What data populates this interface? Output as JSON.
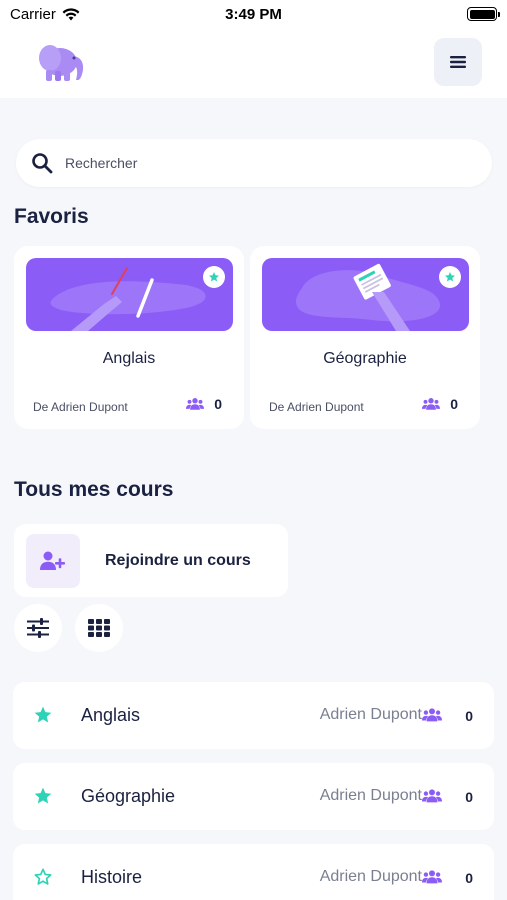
{
  "status_bar": {
    "carrier": "Carrier",
    "time": "3:49 PM"
  },
  "header": {
    "logo_icon": "elephant-logo",
    "menu_icon": "hamburger-icon"
  },
  "search": {
    "placeholder": "Rechercher",
    "value": ""
  },
  "favorites": {
    "title": "Favoris",
    "cards": [
      {
        "title": "Anglais",
        "author": "De Adrien Dupont",
        "members": "0"
      },
      {
        "title": "Géographie",
        "author": "De Adrien Dupont",
        "members": "0"
      }
    ]
  },
  "courses": {
    "title": "Tous mes cours",
    "join_label": "Rejoindre un cours",
    "rows": [
      {
        "name": "Anglais",
        "author": "Adrien Dupont",
        "members": "0",
        "favorite": true
      },
      {
        "name": "Géographie",
        "author": "Adrien Dupont",
        "members": "0",
        "favorite": true
      },
      {
        "name": "Histoire",
        "author": "Adrien Dupont",
        "members": "0",
        "favorite": false
      }
    ]
  },
  "colors": {
    "accent": "#8C5CF6",
    "star": "#2ED3B7",
    "text": "#1B2140",
    "muted": "#7A7F91",
    "background": "#F6F7FB"
  }
}
